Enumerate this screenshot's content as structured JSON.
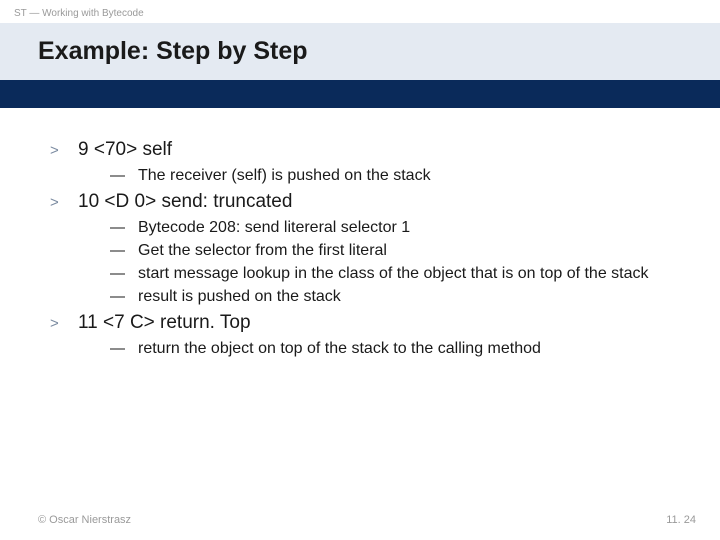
{
  "header": "ST — Working with Bytecode",
  "title": "Example: Step by Step",
  "steps": [
    {
      "head": "9 <70> self",
      "subs": [
        "The receiver (self) is pushed on the stack"
      ]
    },
    {
      "head": "10 <D 0> send: truncated",
      "subs": [
        "Bytecode 208:  send litereral selector 1",
        "Get the selector from the first literal",
        "start message lookup in the class of the object that is on top of the stack",
        "result is pushed on the stack"
      ]
    },
    {
      "head": "11 <7 C> return. Top",
      "subs": [
        "return the object on top of the stack to the calling method"
      ]
    }
  ],
  "footer": {
    "copyright": "© Oscar Nierstrasz",
    "page": "11. 24"
  },
  "glyphs": {
    "gt": ">",
    "dash": "—"
  }
}
